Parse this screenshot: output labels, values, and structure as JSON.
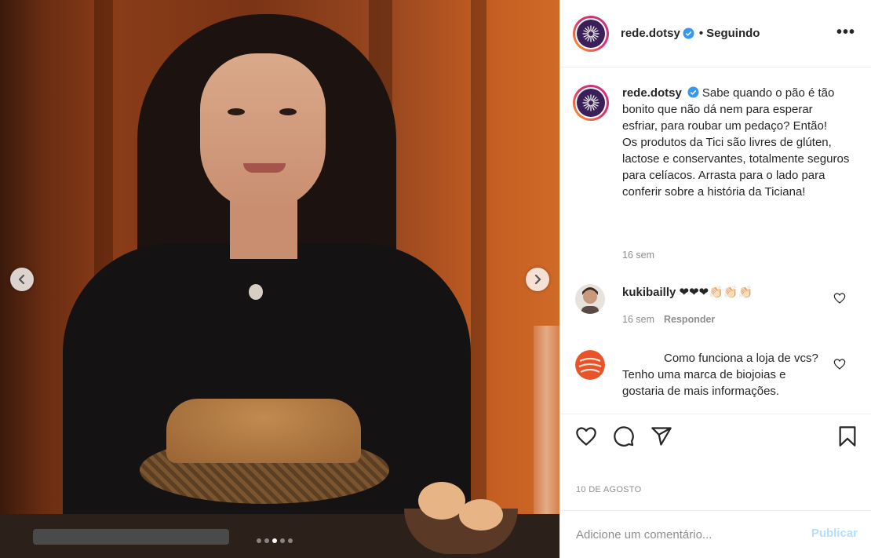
{
  "post": {
    "username": "rede.dotsy",
    "separator": "•",
    "following_label": "Seguindo",
    "more_label": "•••",
    "caption": "Sabe quando o pão é tão bonito que não dá nem para esperar esfriar, para roubar um pedaço? Então!\nOs produtos da Tici são livres de glúten, lactose e conservantes, totalmente seguros para celíacos. Arrasta para o lado para conferir sobre a história da Ticiana!",
    "caption_time": "16 sem",
    "date": "10 DE AGOSTO",
    "carousel": {
      "total": 5,
      "active": 3
    }
  },
  "comments": [
    {
      "username": "kukibailly",
      "text": "❤❤❤👏🏻👏🏻👏🏻",
      "time": "16 sem",
      "reply_label": "Responder"
    },
    {
      "username": "",
      "text": "Como funciona a loja de vcs? Tenho uma marca de biojoias e gostaria de mais informações."
    }
  ],
  "add_comment": {
    "placeholder": "Adicione um comentário...",
    "publish_label": "Publicar"
  },
  "colors": {
    "accent": "#0095f6",
    "publish_disabled": "#b2dffc",
    "verified": "#3897f0",
    "avatar_bg": "#3a1f58"
  },
  "icons": {
    "like": "heart-icon",
    "comment": "comment-icon",
    "share": "share-icon",
    "save": "bookmark-icon",
    "prev": "chevron-left-icon",
    "next": "chevron-right-icon"
  }
}
